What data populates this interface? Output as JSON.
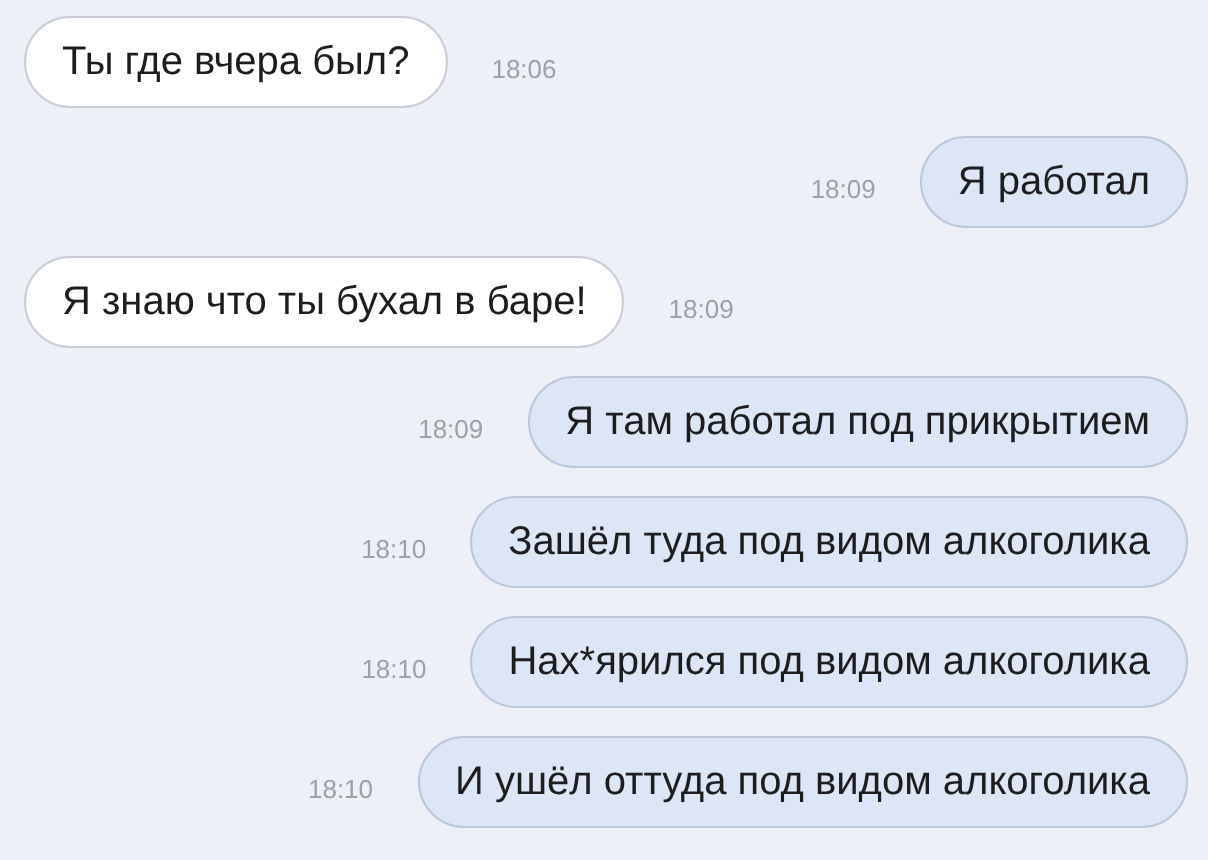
{
  "messages": [
    {
      "kind": "incoming",
      "text": "Ты где вчера был?",
      "time": "18:06"
    },
    {
      "kind": "outgoing",
      "text": "Я работал",
      "time": "18:09"
    },
    {
      "kind": "incoming",
      "text": "Я знаю что ты бухал в баре!",
      "time": "18:09"
    },
    {
      "kind": "outgoing",
      "text": "Я там работал под прикрытием",
      "time": "18:09"
    },
    {
      "kind": "outgoing",
      "text": "Зашёл туда под видом алкоголика",
      "time": "18:10"
    },
    {
      "kind": "outgoing",
      "text": "Нах*ярился под видом алкоголика",
      "time": "18:10"
    },
    {
      "kind": "outgoing",
      "text": "И ушёл оттуда под видом алкоголика",
      "time": "18:10"
    }
  ]
}
